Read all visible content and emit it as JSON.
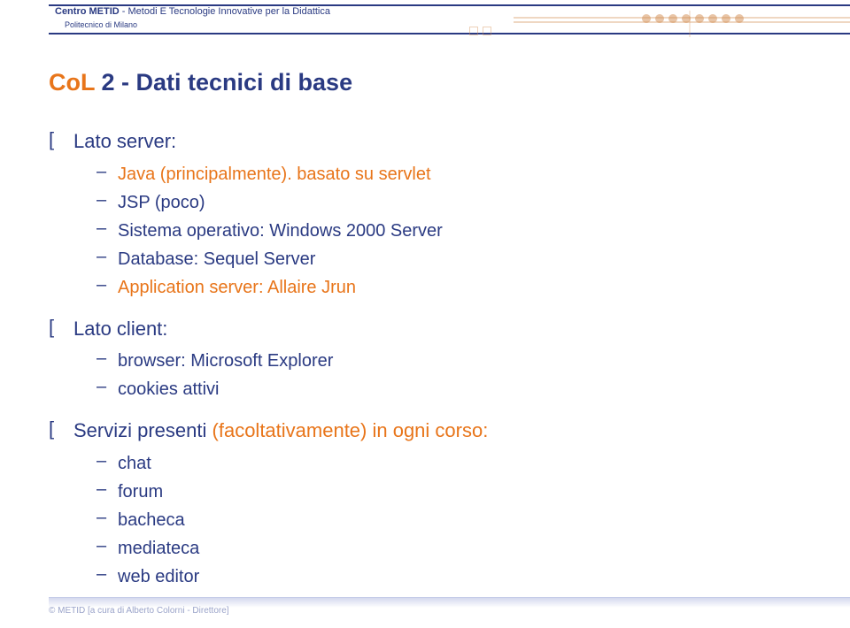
{
  "header": {
    "title_bold": "Centro METID",
    "title_rest": " - Metodi E Tecnologie Innovative per la Didattica",
    "subtitle": "Politecnico di Milano"
  },
  "slide": {
    "title_highlight": "CoL",
    "title_rest": " 2 - Dati tecnici di base",
    "bullets": [
      {
        "label": "Lato server:",
        "accent_inline": "",
        "children": [
          {
            "text": "Java (principalmente). basato su servlet",
            "accent": true
          },
          {
            "text": "JSP (poco)",
            "accent": false
          },
          {
            "text": "Sistema operativo: Windows 2000 Server",
            "accent": false
          },
          {
            "text": "Database: Sequel Server",
            "accent": false
          },
          {
            "text": "Application server: Allaire Jrun",
            "accent": true
          }
        ]
      },
      {
        "label": "Lato client:",
        "accent_inline": "",
        "children": [
          {
            "text": "browser: Microsoft Explorer",
            "accent": false
          },
          {
            "text": "cookies attivi",
            "accent": false
          }
        ]
      },
      {
        "label": "Servizi presenti ",
        "accent_inline": "(facoltativamente) in ogni corso:",
        "children": [
          {
            "text": "chat",
            "accent": false
          },
          {
            "text": "forum",
            "accent": false
          },
          {
            "text": "bacheca",
            "accent": false
          },
          {
            "text": "mediateca",
            "accent": false
          },
          {
            "text": "web editor",
            "accent": false
          }
        ]
      }
    ]
  },
  "footer": {
    "copyright": "© METID [a cura di Alberto Colorni - Direttore]"
  }
}
